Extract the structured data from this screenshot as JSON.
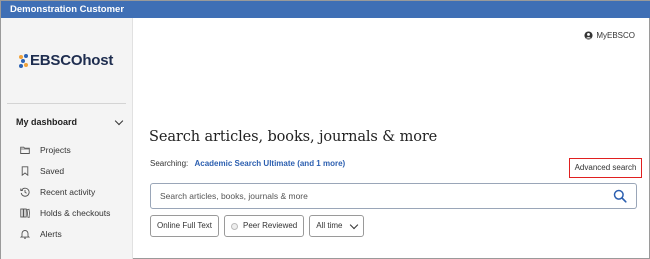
{
  "topbar": {
    "title": "Demonstration Customer"
  },
  "brand": {
    "logo_text": "EBSCOhost",
    "accent": "#2b62b4"
  },
  "header": {
    "account_label": "MyEBSCO"
  },
  "sidebar": {
    "section_title": "My dashboard",
    "items": [
      {
        "label": "Projects",
        "icon": "folder-icon"
      },
      {
        "label": "Saved",
        "icon": "bookmark-icon"
      },
      {
        "label": "Recent activity",
        "icon": "history-icon"
      },
      {
        "label": "Holds & checkouts",
        "icon": "books-icon"
      },
      {
        "label": "Alerts",
        "icon": "bell-icon"
      }
    ]
  },
  "main": {
    "heading": "Search articles, books, journals & more",
    "searching_label": "Searching:",
    "searching_db": "Academic Search Ultimate (and 1 more)",
    "advanced_search": "Advanced search",
    "search_placeholder": "Search articles, books, journals & more",
    "filters": {
      "full_text": "Online Full Text",
      "peer_reviewed": "Peer Reviewed",
      "date_range": "All time"
    }
  }
}
